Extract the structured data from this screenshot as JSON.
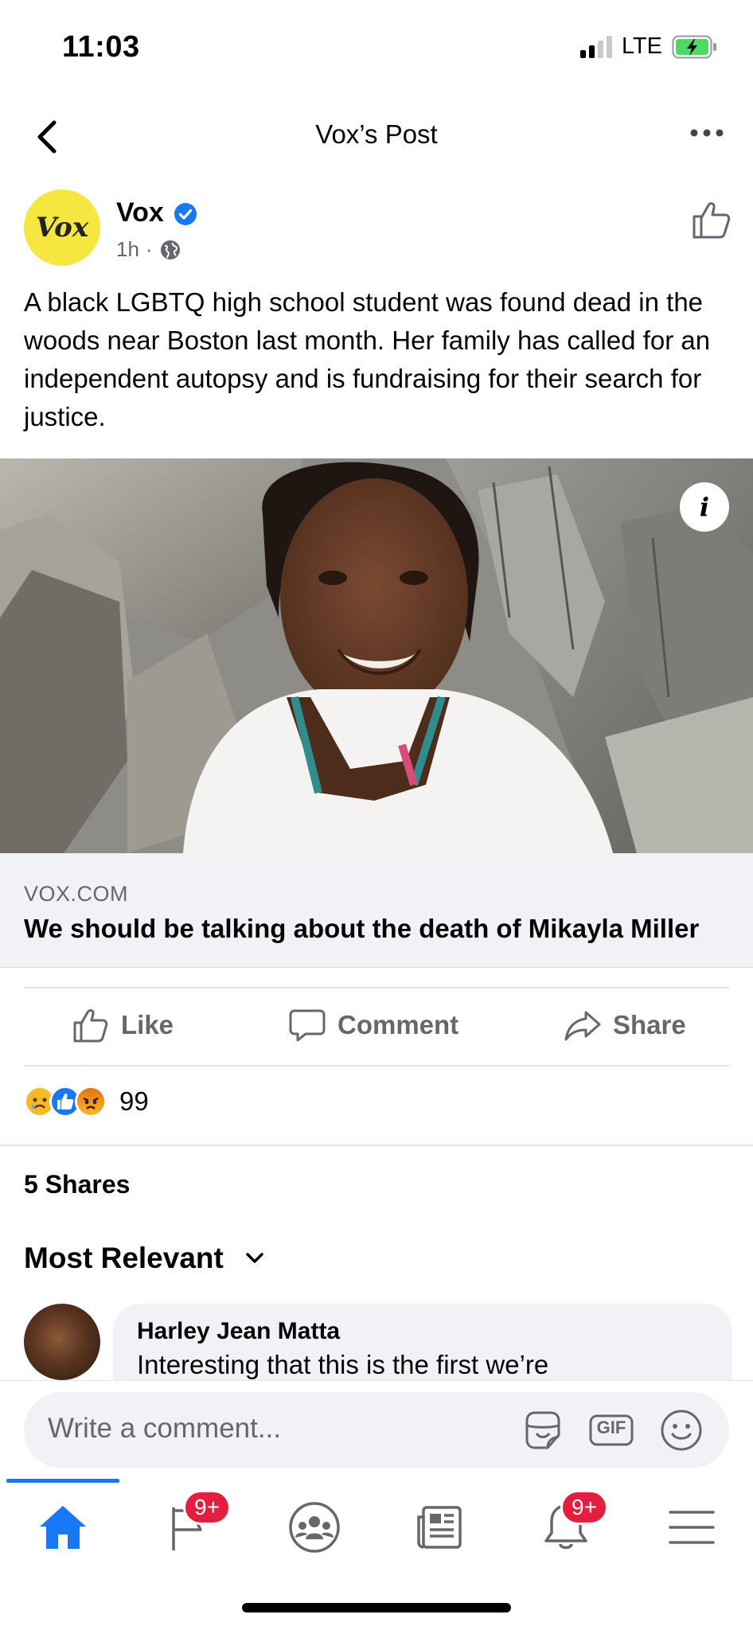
{
  "status_bar": {
    "time": "11:03",
    "network": "LTE",
    "icons": [
      "signal-icon",
      "battery-charging-icon"
    ]
  },
  "nav": {
    "title": "Vox’s Post",
    "icons": [
      "back-chevron-icon",
      "more-dots-icon"
    ]
  },
  "post": {
    "author": "Vox",
    "avatar_text": "Vox",
    "time": "1h",
    "separator": "·",
    "text": "A black LGBTQ high school student was found dead in the woods near Boston last month. Her family has called for an independent autopsy and is fundraising for their search for justice.",
    "image_info_label": "i",
    "link": {
      "domain": "VOX.COM",
      "title": "We should be talking about the death of Mikayla Miller"
    }
  },
  "actions": {
    "like": "Like",
    "comment": "Comment",
    "share": "Share"
  },
  "reactions": {
    "types": [
      "sad",
      "like",
      "angry"
    ],
    "count": "99"
  },
  "shares": "5 Shares",
  "comments_filter": "Most Relevant",
  "comments": [
    {
      "author": "Harley Jean Matta",
      "text": "Interesting that this is the first we’re"
    }
  ],
  "composer": {
    "placeholder": "Write a comment...",
    "gif_label": "GIF"
  },
  "tab_bar": {
    "tabs": [
      "home",
      "pages",
      "groups",
      "news",
      "notifications",
      "menu"
    ],
    "pages_badge": "9+",
    "notifications_badge": "9+"
  },
  "colors": {
    "accent": "#1877f2",
    "badge": "#e41e3f",
    "secondary_text": "#65676b",
    "vox_yellow": "#f5e640",
    "battery_green": "#4cd964"
  }
}
